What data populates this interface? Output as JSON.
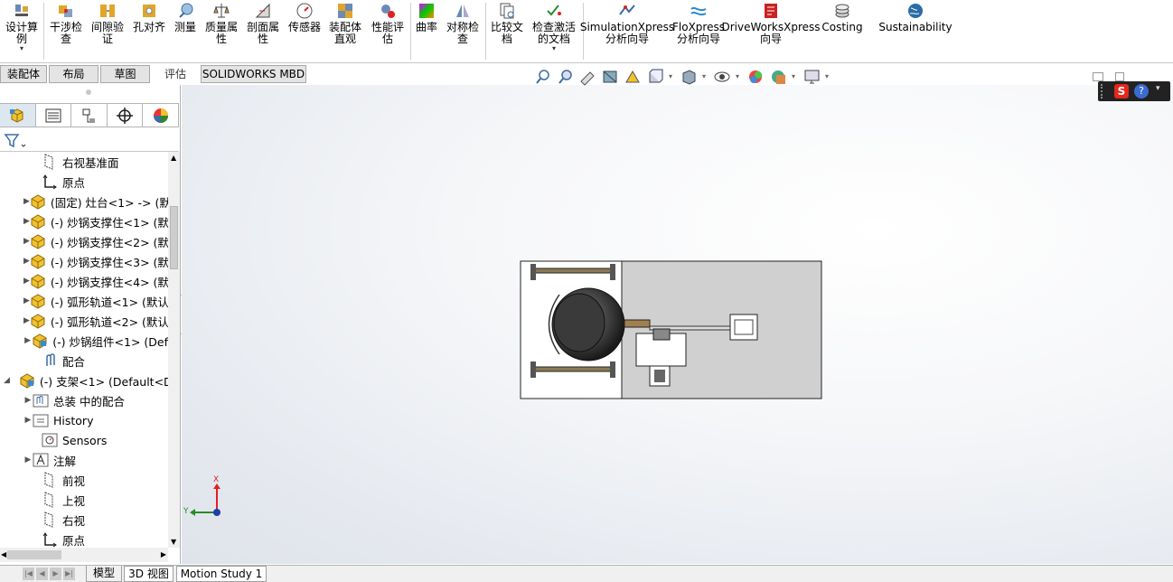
{
  "ribbon": {
    "design_study": "设计算\n例",
    "interference": "干涉检\n查",
    "clearance": "间隙验\n证",
    "hole_align": "孔对齐",
    "measure": "测量",
    "mass_props": "质量属\n性",
    "section_props": "剖面属\n性",
    "sensor": "传感器",
    "asm_visual": "装配体\n直观",
    "perf_eval": "性能评\n估",
    "curvature": "曲率",
    "symmetry": "对称检\n查",
    "compare": "比较文\n档",
    "check_active": "检查激活\n的文档",
    "simxpress": "SimulationXpress\n分析向导",
    "floxpress": "FloXpress\n分析向导",
    "driveworks": "DriveWorksXpress\n向导",
    "costing": "Costing",
    "sustainability": "Sustainability"
  },
  "command_tabs": [
    "装配体",
    "布局",
    "草图",
    "评估",
    "SOLIDWORKS MBD"
  ],
  "tree": {
    "items": [
      {
        "label": "右视基准面",
        "type": "plane"
      },
      {
        "label": "原点",
        "type": "origin"
      },
      {
        "label": "(固定) 灶台<1> -> (默",
        "type": "part"
      },
      {
        "label": "(-) 炒锅支撑住<1> (默",
        "type": "part"
      },
      {
        "label": "(-) 炒锅支撑住<2> (默",
        "type": "part"
      },
      {
        "label": "(-) 炒锅支撑住<3> (默",
        "type": "part"
      },
      {
        "label": "(-) 炒锅支撑住<4> (默",
        "type": "part"
      },
      {
        "label": "(-) 弧形轨道<1> (默认",
        "type": "part"
      },
      {
        "label": "(-) 弧形轨道<2> (默认",
        "type": "part"
      },
      {
        "label": "(-) 炒锅组件<1> (Def",
        "type": "assembly"
      },
      {
        "label": "配合",
        "type": "mates"
      },
      {
        "label": "(-) 支架<1> (Default<De",
        "type": "assembly"
      },
      {
        "label": "总装 中的配合",
        "type": "mates-folder"
      },
      {
        "label": "History",
        "type": "history"
      },
      {
        "label": "Sensors",
        "type": "sensors"
      },
      {
        "label": "注解",
        "type": "annotations"
      },
      {
        "label": "前视",
        "type": "plane"
      },
      {
        "label": "上视",
        "type": "plane"
      },
      {
        "label": "右视",
        "type": "plane"
      },
      {
        "label": "原点",
        "type": "origin"
      }
    ]
  },
  "bottom_tabs": [
    "模型",
    "3D 视图",
    "Motion Study 1"
  ],
  "triad": {
    "x_label": "X",
    "y_label": "Y"
  },
  "colors": {
    "accent": "#1f5fa8",
    "viewport_bg": "#eef0f4",
    "part_yellow": "#f2c12e"
  }
}
